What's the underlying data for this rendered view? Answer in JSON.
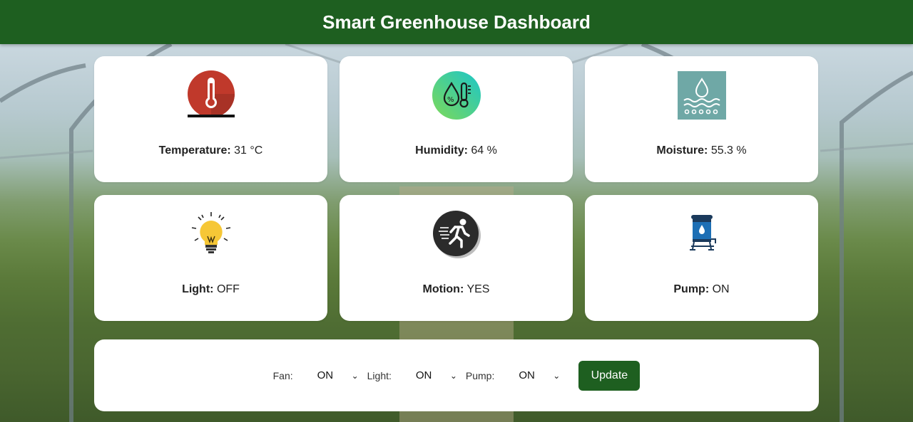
{
  "header": {
    "title": "Smart Greenhouse Dashboard"
  },
  "colors": {
    "brand": "#1e5f20",
    "card": "#ffffff"
  },
  "sensors": [
    {
      "label": "Temperature:",
      "value": "31 °C",
      "icon": "thermometer-icon"
    },
    {
      "label": "Humidity:",
      "value": "64 %",
      "icon": "humidity-icon"
    },
    {
      "label": "Moisture:",
      "value": "55.3 %",
      "icon": "moisture-icon"
    },
    {
      "label": "Light:",
      "value": "OFF",
      "icon": "light-bulb-icon"
    },
    {
      "label": "Motion:",
      "value": "YES",
      "icon": "motion-runner-icon"
    },
    {
      "label": "Pump:",
      "value": "ON",
      "icon": "water-pump-icon"
    }
  ],
  "controls": {
    "fan_label": "Fan:",
    "fan_value": "ON",
    "light_label": "Light:",
    "light_value": "ON",
    "pump_label": "Pump:",
    "pump_value": "ON",
    "update_label": "Update"
  }
}
